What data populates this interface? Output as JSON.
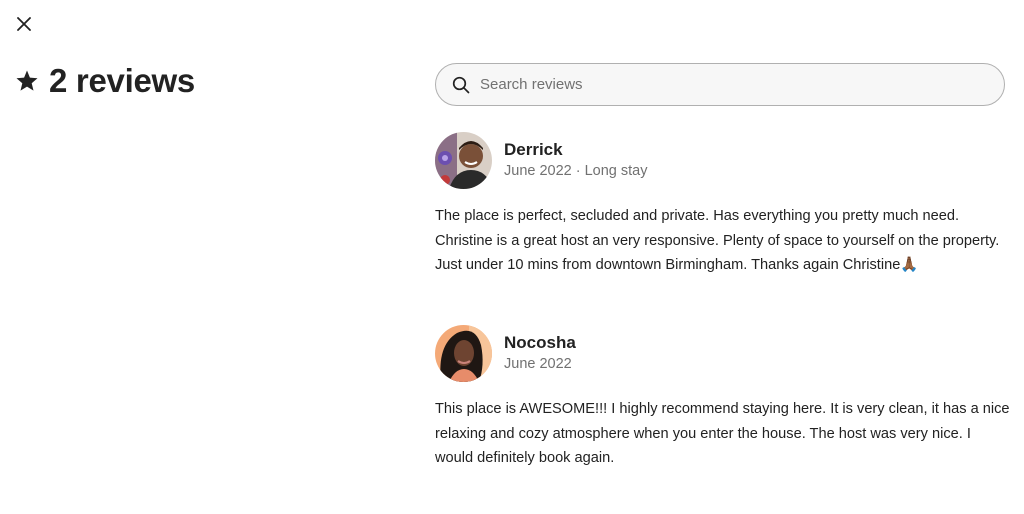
{
  "modal": {
    "close_icon": "close-icon"
  },
  "summary": {
    "icon": "star-icon",
    "title": "2 reviews"
  },
  "search": {
    "icon": "search-icon",
    "placeholder": "Search reviews",
    "value": ""
  },
  "reviews": [
    {
      "name": "Derrick",
      "date": "June 2022 · Long stay",
      "text": "The place is perfect, secluded and private. Has everything you pretty much need. Christine is a great host an very responsive. Plenty of space to yourself on the property. Just under 10 mins from downtown Birmingham. Thanks again Christine🙏🏾"
    },
    {
      "name": "Nocosha",
      "date": "June 2022",
      "text": "This place is AWESOME!!! I highly recommend staying here. It is very clean, it has a nice relaxing and cozy atmosphere when you enter the house. The host was very nice. I would definitely book again."
    }
  ],
  "colors": {
    "text_primary": "#222222",
    "text_secondary": "#717171",
    "search_border": "#b0b0b0",
    "search_bg": "#f7f7f7"
  }
}
